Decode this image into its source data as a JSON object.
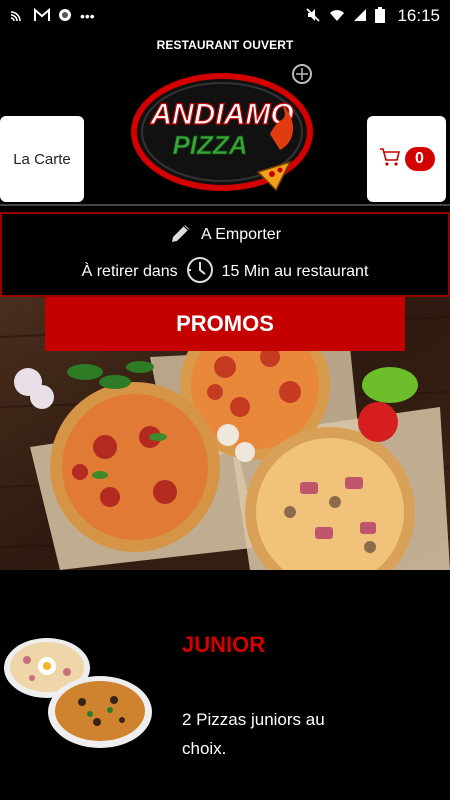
{
  "status_bar": {
    "time": "16:15",
    "left_icons": [
      "cast-icon",
      "gmail-icon",
      "app-icon",
      "more-dots"
    ],
    "right_icons": [
      "mute-icon",
      "wifi-icon",
      "signal-icon",
      "battery-icon"
    ]
  },
  "header": {
    "open_status": "RESTAURANT OUVERT",
    "logo_line1": "ANDIAMO",
    "logo_line2": "PIZZA",
    "carte_label": "La Carte",
    "cart_count": "0"
  },
  "pickup": {
    "mode_label": "A Emporter",
    "time_prefix": "À retirer dans",
    "time_suffix": "15 Min au restaurant"
  },
  "promo": {
    "button_label": "PROMOS"
  },
  "product": {
    "title": "JUNIOR",
    "description": "2 Pizzas juniors au choix."
  },
  "colors": {
    "accent_red": "#c40000",
    "background": "#000000"
  }
}
